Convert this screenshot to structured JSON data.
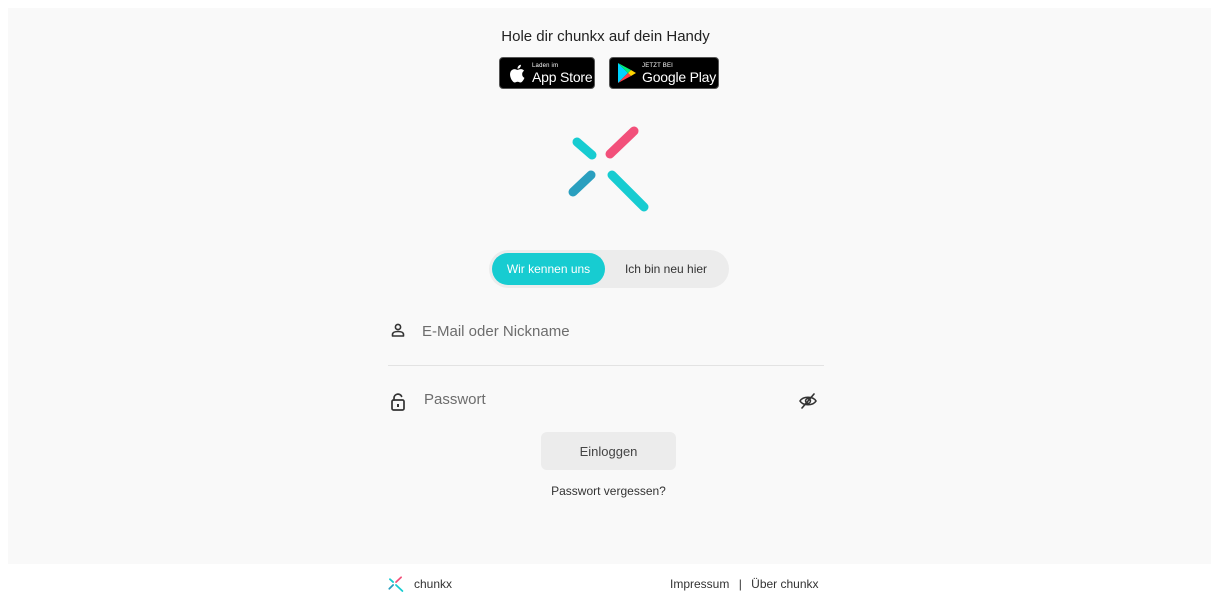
{
  "promo": {
    "title": "Hole dir chunkx auf dein Handy",
    "app_store": {
      "small": "Laden im",
      "big": "App Store",
      "icon": "apple-icon"
    },
    "google_play": {
      "small": "JETZT BEI",
      "big": "Google Play",
      "icon": "google-play-icon"
    }
  },
  "brand": {
    "colors": {
      "teal": "#17ccd1",
      "pink": "#f2507a",
      "blue": "#2a9fbf"
    }
  },
  "toggle": {
    "active_label": "Wir kennen uns",
    "inactive_label": "Ich bin neu hier"
  },
  "form": {
    "user_placeholder": "E-Mail oder Nickname",
    "user_value": "",
    "pass_placeholder": "Passwort",
    "pass_value": "",
    "login_label": "Einloggen",
    "forgot_label": "Passwort vergessen?"
  },
  "footer": {
    "brand": "chunkx",
    "impressum": "Impressum",
    "separator": "|",
    "about": "Über chunkx"
  }
}
